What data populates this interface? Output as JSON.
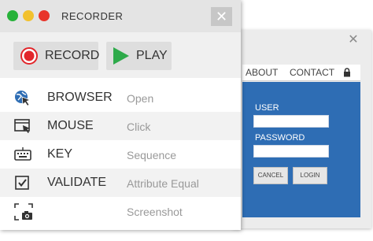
{
  "recorder": {
    "title": "RECORDER",
    "record_label": "RECORD",
    "play_label": "PLAY",
    "close_icon": "close-icon",
    "window_dots": [
      "#27b23a",
      "#f2c12e",
      "#e8352a"
    ]
  },
  "actions": [
    {
      "name": "BROWSER",
      "desc": "Open",
      "icon": "globe-cursor-icon"
    },
    {
      "name": "MOUSE",
      "desc": "Click",
      "icon": "window-cursor-icon"
    },
    {
      "name": "KEY",
      "desc": "Sequence",
      "icon": "keyboard-icon"
    },
    {
      "name": "VALIDATE",
      "desc": "Attribute Equal",
      "icon": "checkbox-icon"
    },
    {
      "name": "",
      "desc": "Screenshot",
      "icon": "screenshot-icon"
    }
  ],
  "browser": {
    "nav": [
      "ABOUT",
      "CONTACT"
    ],
    "user_label": "USER",
    "password_label": "PASSWORD",
    "cancel_label": "CANCEL",
    "login_label": "LOGIN",
    "panel_color": "#2e6db4"
  }
}
